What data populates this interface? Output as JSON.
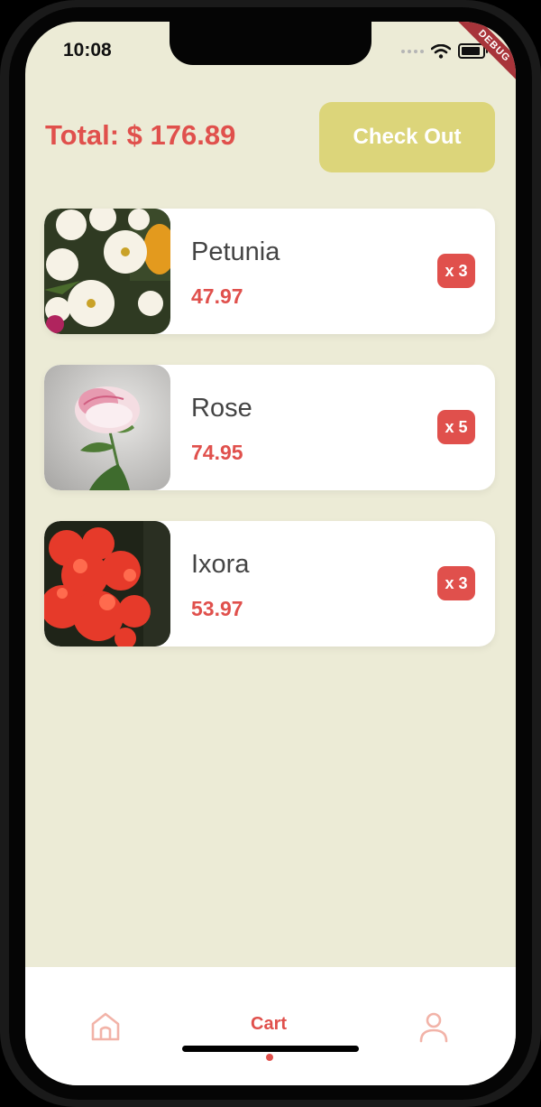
{
  "status_bar": {
    "time": "10:08"
  },
  "debug_banner": "DEBUG",
  "header": {
    "total_label": "Total: $ 176.89",
    "checkout_label": "Check Out"
  },
  "cart_items": [
    {
      "name": "Petunia",
      "price": "47.97",
      "quantity": "x 3",
      "image": "petunia-flowers"
    },
    {
      "name": "Rose",
      "price": "74.95",
      "quantity": "x 5",
      "image": "pink-white-rose"
    },
    {
      "name": "Ixora",
      "price": "53.97",
      "quantity": "x 3",
      "image": "red-ixora-flowers"
    }
  ],
  "bottom_nav": {
    "items": [
      {
        "icon": "home-icon"
      },
      {
        "label": "Cart"
      },
      {
        "icon": "profile-icon"
      }
    ]
  },
  "colors": {
    "background": "#ecebd6",
    "accent": "#e0504c",
    "checkout_button": "#dcd57a",
    "nav_icon": "#f2b3a8"
  }
}
